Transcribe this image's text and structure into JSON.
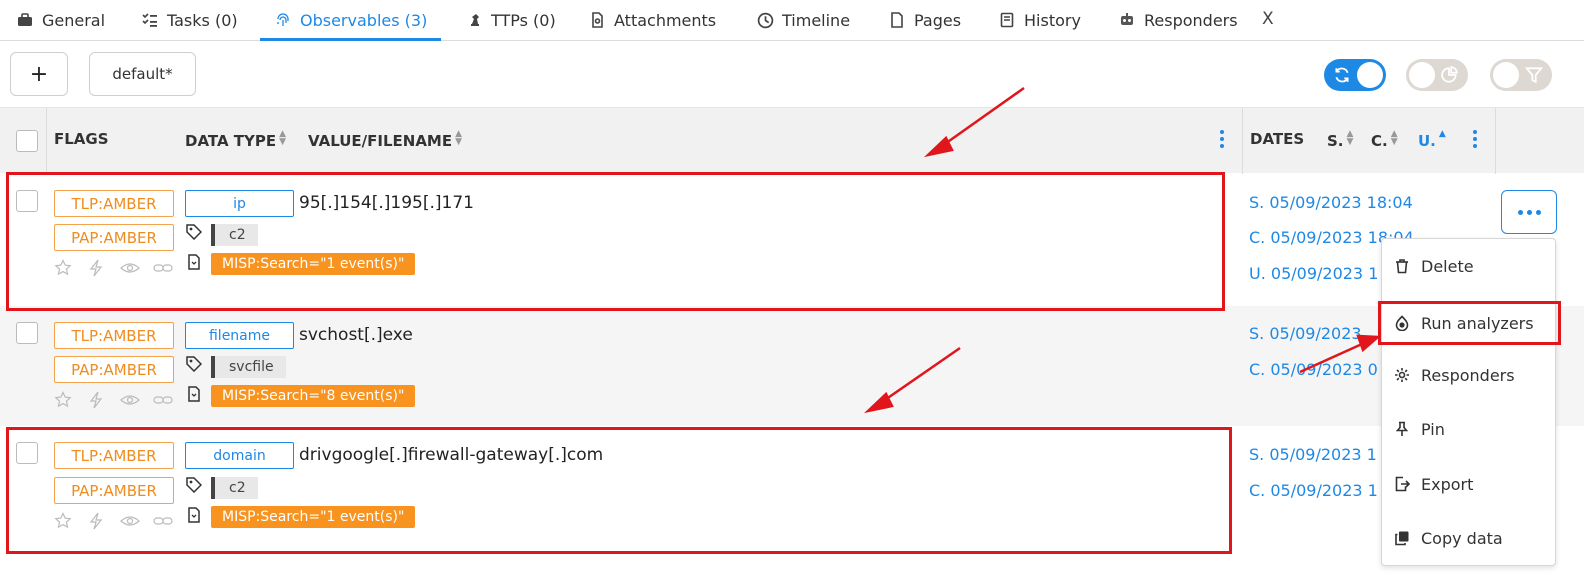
{
  "tabs": [
    {
      "label": "General",
      "icon": "briefcase-icon"
    },
    {
      "label": "Tasks (0)",
      "icon": "tasks-icon"
    },
    {
      "label": "Observables (3)",
      "icon": "fingerprint-icon",
      "active": true
    },
    {
      "label": "TTPs (0)",
      "icon": "chess-icon"
    },
    {
      "label": "Attachments",
      "icon": "attachment-icon"
    },
    {
      "label": "Timeline",
      "icon": "clock-icon"
    },
    {
      "label": "Pages",
      "icon": "page-icon"
    },
    {
      "label": "History",
      "icon": "book-icon"
    },
    {
      "label": "Responders",
      "icon": "responders-icon"
    }
  ],
  "tab_close": "X",
  "toolbar": {
    "add_label": "+",
    "preset_label": "default*"
  },
  "header": {
    "flags": "FLAGS",
    "data_type": "DATA TYPE",
    "value": "VALUE/FILENAME",
    "dates": "DATES",
    "s": "S.",
    "c": "C.",
    "u": "U."
  },
  "rows": [
    {
      "tlp": "TLP:AMBER",
      "pap": "PAP:AMBER",
      "data_type": "ip",
      "value": "95[.]154[.]195[.]171",
      "tag": "c2",
      "misp": "MISP:Search=\"1 event(s)\"",
      "dates": [
        "S. 05/09/2023 18:04",
        "C. 05/09/2023 18:04",
        "U. 05/09/2023 1"
      ]
    },
    {
      "tlp": "TLP:AMBER",
      "pap": "PAP:AMBER",
      "data_type": "filename",
      "value": "svchost[.]exe",
      "tag": "svcfile",
      "misp": "MISP:Search=\"8 event(s)\"",
      "dates": [
        "S. 05/09/2023",
        "C. 05/09/2023 0"
      ]
    },
    {
      "tlp": "TLP:AMBER",
      "pap": "PAP:AMBER",
      "data_type": "domain",
      "value": "drivgoogle[.]firewall-gateway[.]com",
      "tag": "c2",
      "misp": "MISP:Search=\"1 event(s)\"",
      "dates": [
        "S. 05/09/2023 1",
        "C. 05/09/2023 1"
      ]
    }
  ],
  "menu": {
    "items": [
      {
        "label": "Delete",
        "icon": "trash-icon"
      },
      {
        "label": "Run analyzers",
        "icon": "analyzer-icon"
      },
      {
        "label": "Responders",
        "icon": "gear-icon"
      },
      {
        "label": "Pin",
        "icon": "pin-icon"
      },
      {
        "label": "Export",
        "icon": "export-icon"
      },
      {
        "label": "Copy data",
        "icon": "copy-icon"
      }
    ]
  },
  "colors": {
    "accent": "#1e88e5",
    "amber": "#f4a24b",
    "misp": "#f7931e",
    "annotation": "#e0161c"
  }
}
